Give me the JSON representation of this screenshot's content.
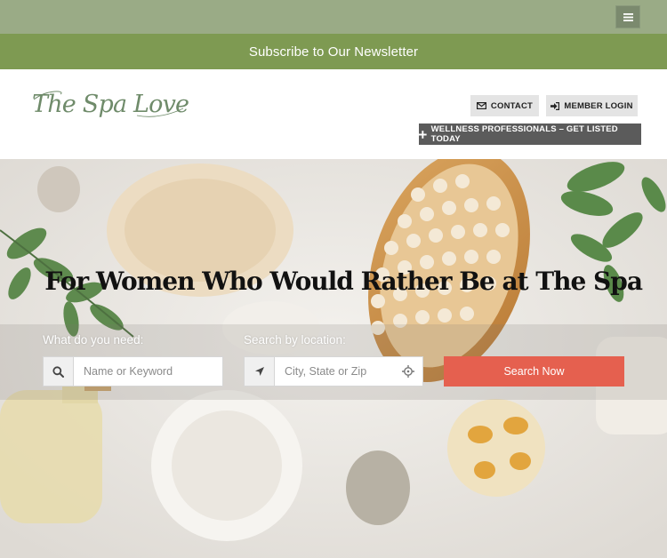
{
  "topbar": {
    "menu_icon": "hamburger-icon"
  },
  "newsletter": {
    "label": "Subscribe to Our Newsletter"
  },
  "header": {
    "logo_text": "The Spa Lover",
    "contact_label": "CONTACT",
    "contact_icon": "envelope-icon",
    "login_label": "MEMBER LOGIN",
    "login_icon": "sign-in-icon",
    "wellness_label": "WELLNESS PROFESSIONALS – GET LISTED TODAY",
    "wellness_icon": "plus-icon"
  },
  "hero": {
    "headline": "For Women Who Would Rather Be at The Spa",
    "search": {
      "need_label": "What do you need:",
      "keyword_placeholder": "Name or Keyword",
      "keyword_value": "",
      "location_label": "Search by location:",
      "location_placeholder": "City, State or Zip",
      "location_value": "",
      "button_label": "Search Now"
    }
  },
  "colors": {
    "topbar": "#9aab86",
    "newsletter": "#7e9a52",
    "logo": "#6f8b6a",
    "search_button": "#e5604f",
    "dark_button": "#5b5b5b",
    "light_button": "#e4e4e4"
  }
}
